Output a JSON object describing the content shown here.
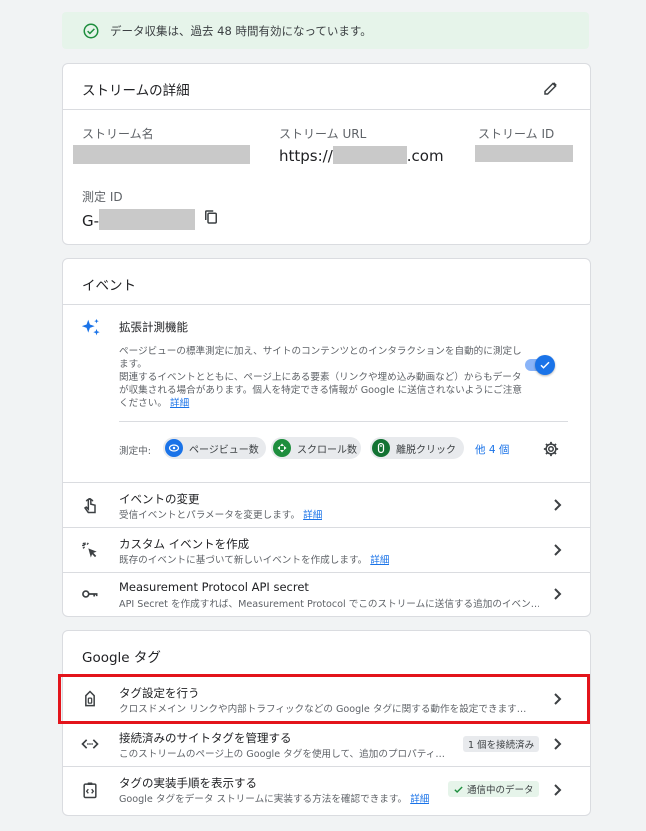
{
  "banner": {
    "text": "データ収集は、過去 48 時間有効になっています。"
  },
  "stream_details": {
    "title": "ストリームの詳細",
    "stream_name_label": "ストリーム名",
    "stream_url_label": "ストリーム URL",
    "stream_url_prefix": "https://",
    "stream_url_suffix": ".com",
    "stream_id_label": "ストリーム ID",
    "measurement_id_label": "測定 ID",
    "measurement_id_prefix": "G-"
  },
  "events": {
    "title": "イベント",
    "enhanced": {
      "title": "拡張計測機能",
      "desc": "ページビューの標準測定に加え、サイトのコンテンツとのインタラクションを自動的に測定します。",
      "desc2": "関連するイベントとともに、ページ上にある要素（リンクや埋め込み動画など）からもデータが収集される場合があります。個人を特定できる情報が Google に送信されないようにご注意ください。",
      "link": "詳細",
      "toggle_on": true
    },
    "measuring_label": "測定中:",
    "chips": [
      {
        "label": "ページビュー数",
        "color": "#1a73e8"
      },
      {
        "label": "スクロール数",
        "color": "#1e8e3e"
      },
      {
        "label": "離脱クリック",
        "color": "#137333"
      }
    ],
    "more": "他 4 個",
    "rows": [
      {
        "title": "イベントの変更",
        "sub": "受信イベントとパラメータを変更します。",
        "link": "詳細"
      },
      {
        "title": "カスタム イベントを作成",
        "sub": "既存のイベントに基づいて新しいイベントを作成します。",
        "link": "詳細"
      },
      {
        "title": "Measurement Protocol API secret",
        "sub": "API Secret を作成すれば、Measurement Protocol でこのストリームに送信する追加のイベン…",
        "link": ""
      }
    ]
  },
  "google_tag": {
    "title": "Google タグ",
    "rows": [
      {
        "title": "タグ設定を行う",
        "sub": "クロスドメイン リンクや内部トラフィックなどの Google タグに関する動作を設定できます…",
        "badge": ""
      },
      {
        "title": "接続済みのサイトタグを管理する",
        "sub": "このストリームのページ上の Google タグを使用して、追加のプロパティ…",
        "badge": "1 個を接続済み"
      },
      {
        "title": "タグの実装手順を表示する",
        "sub": "Google タグをデータ ストリームに実装する方法を確認できます。",
        "link": "詳細",
        "badge": "通信中のデータ"
      }
    ]
  },
  "colors": {
    "highlight": "#e3141b",
    "accent": "#1a73e8",
    "success": "#1e8e3e"
  }
}
